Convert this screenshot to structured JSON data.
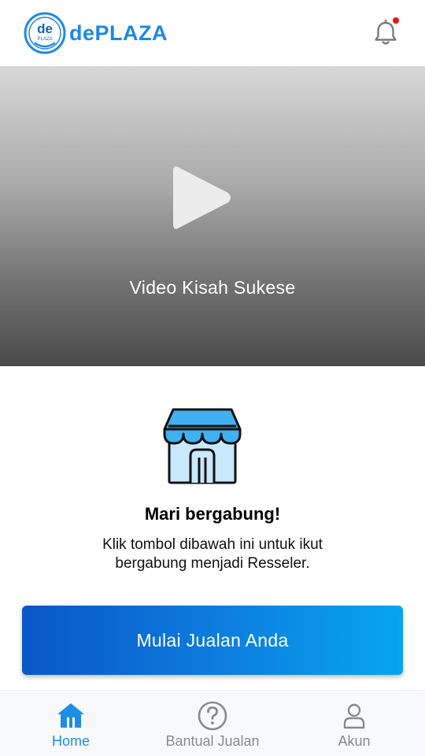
{
  "header": {
    "logo_mark_text": "de",
    "logo_mark_subtext": "PLAZA",
    "logo_text": "dePLAZA",
    "bell_icon": "bell-icon",
    "has_notification": true,
    "notification_dot_color": "#e8120c"
  },
  "video": {
    "title": "Video Kisah Sukese",
    "play_icon": "play-icon"
  },
  "join": {
    "icon": "store-icon",
    "title": "Mari bergabung!",
    "description": "Klik tombol dibawah ini untuk ikut bergabung menjadi Resseler.",
    "cta_label": "Mulai Jualan Anda"
  },
  "bottom_nav": {
    "active_index": 0,
    "items": [
      {
        "label": "Home",
        "icon": "home-icon"
      },
      {
        "label": "Bantual Jualan",
        "icon": "help-icon"
      },
      {
        "label": "Akun",
        "icon": "user-icon"
      }
    ]
  },
  "colors": {
    "brand": "#1e88e5",
    "active_nav": "#1a8fe3",
    "inactive_nav": "#8a8a8a",
    "cta_gradient_start": "#0a57c8",
    "cta_gradient_end": "#07a6ef"
  }
}
